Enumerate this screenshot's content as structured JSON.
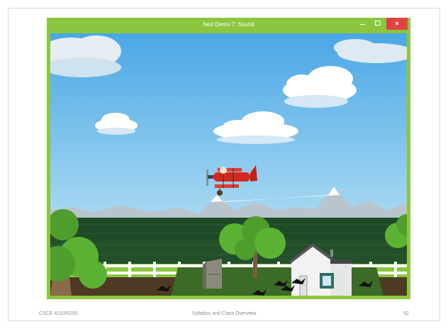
{
  "window": {
    "title": "Ned Demo 7: Sound",
    "close_glyph": "×"
  },
  "scene": {
    "sky_top": "#4aa7e6",
    "sky_bottom": "#a8d9f2",
    "plane_color": "#d42a1e",
    "grass_color": "#3b6b25",
    "house_color": "#f2f2f2"
  },
  "footer": {
    "course": "CSCE 4210/5250",
    "topic": "Syllabus and Class Overview",
    "page": "52"
  }
}
